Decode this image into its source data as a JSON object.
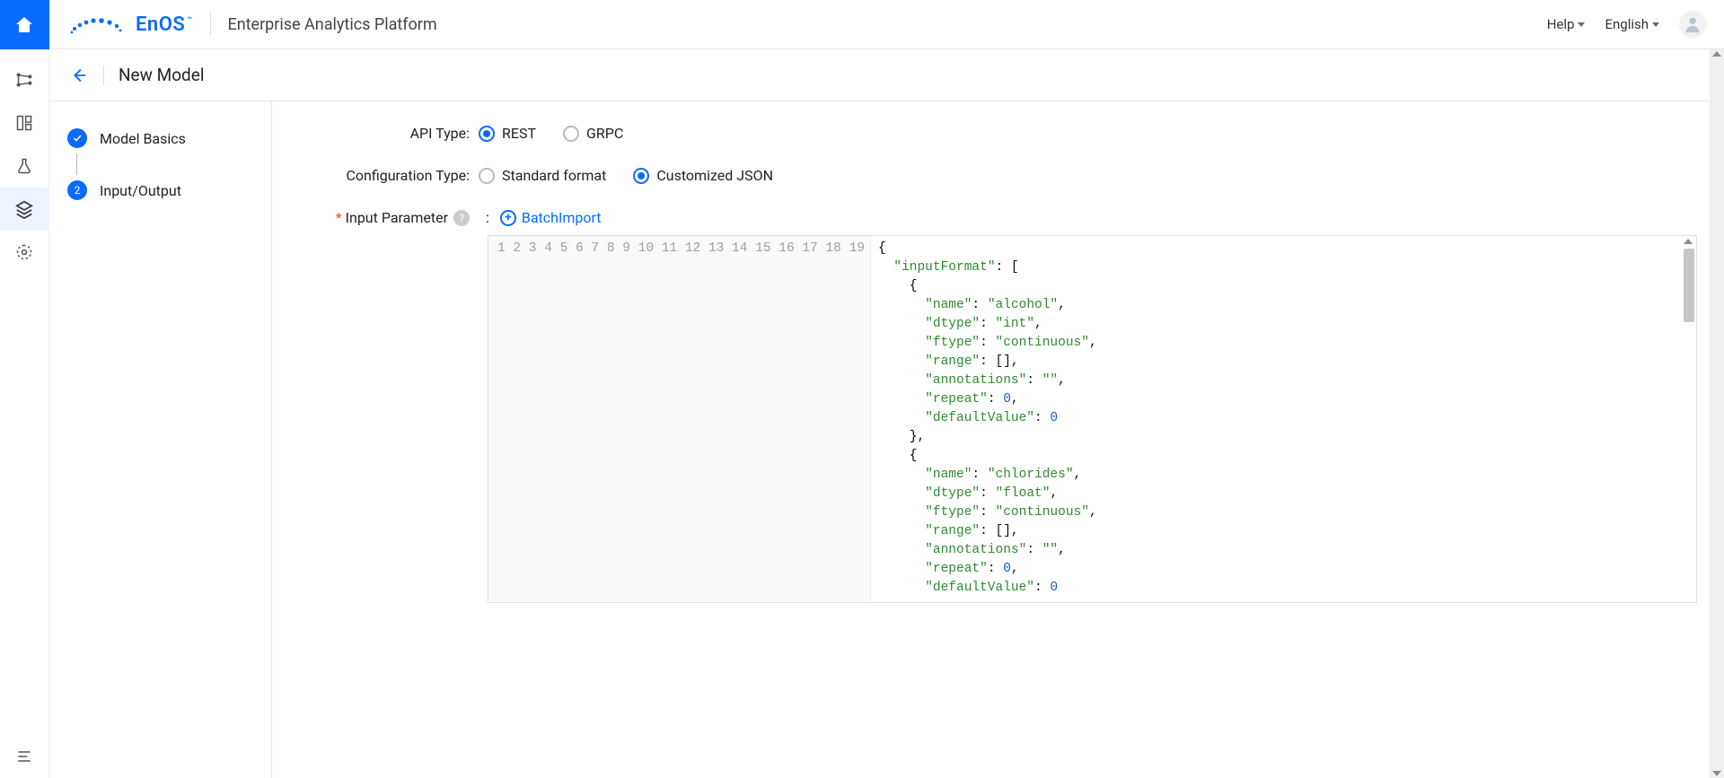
{
  "brand": {
    "name": "EnOS",
    "tm": "™",
    "product": "Enterprise Analytics Platform"
  },
  "topbar": {
    "help": "Help",
    "language": "English"
  },
  "page": {
    "title": "New Model"
  },
  "steps": [
    {
      "label": "Model Basics",
      "badge": "check"
    },
    {
      "label": "Input/Output",
      "badge": "2"
    }
  ],
  "form": {
    "api_type_label": "API Type:",
    "api_type_options": {
      "rest": "REST",
      "grpc": "GRPC"
    },
    "api_type_selected": "rest",
    "config_type_label": "Configuration Type:",
    "config_type_options": {
      "standard": "Standard format",
      "custom": "Customized JSON"
    },
    "config_type_selected": "custom",
    "input_param_label": "Input Parameter",
    "batch_import": "BatchImport"
  },
  "code": {
    "line_count": 19,
    "lines": [
      [
        {
          "t": "brace",
          "v": "{"
        }
      ],
      [
        {
          "t": "plain",
          "v": "  "
        },
        {
          "t": "key",
          "v": "\"inputFormat\""
        },
        {
          "t": "plain",
          "v": ": ["
        }
      ],
      [
        {
          "t": "plain",
          "v": "    "
        },
        {
          "t": "brace",
          "v": "{"
        }
      ],
      [
        {
          "t": "plain",
          "v": "      "
        },
        {
          "t": "key",
          "v": "\"name\""
        },
        {
          "t": "plain",
          "v": ": "
        },
        {
          "t": "str",
          "v": "\"alcohol\""
        },
        {
          "t": "plain",
          "v": ","
        }
      ],
      [
        {
          "t": "plain",
          "v": "      "
        },
        {
          "t": "key",
          "v": "\"dtype\""
        },
        {
          "t": "plain",
          "v": ": "
        },
        {
          "t": "str",
          "v": "\"int\""
        },
        {
          "t": "plain",
          "v": ","
        }
      ],
      [
        {
          "t": "plain",
          "v": "      "
        },
        {
          "t": "key",
          "v": "\"ftype\""
        },
        {
          "t": "plain",
          "v": ": "
        },
        {
          "t": "str",
          "v": "\"continuous\""
        },
        {
          "t": "plain",
          "v": ","
        }
      ],
      [
        {
          "t": "plain",
          "v": "      "
        },
        {
          "t": "key",
          "v": "\"range\""
        },
        {
          "t": "plain",
          "v": ": [],"
        }
      ],
      [
        {
          "t": "plain",
          "v": "      "
        },
        {
          "t": "key",
          "v": "\"annotations\""
        },
        {
          "t": "plain",
          "v": ": "
        },
        {
          "t": "str",
          "v": "\"\""
        },
        {
          "t": "plain",
          "v": ","
        }
      ],
      [
        {
          "t": "plain",
          "v": "      "
        },
        {
          "t": "key",
          "v": "\"repeat\""
        },
        {
          "t": "plain",
          "v": ": "
        },
        {
          "t": "num",
          "v": "0"
        },
        {
          "t": "plain",
          "v": ","
        }
      ],
      [
        {
          "t": "plain",
          "v": "      "
        },
        {
          "t": "key",
          "v": "\"defaultValue\""
        },
        {
          "t": "plain",
          "v": ": "
        },
        {
          "t": "num",
          "v": "0"
        }
      ],
      [
        {
          "t": "plain",
          "v": "    "
        },
        {
          "t": "brace",
          "v": "}"
        },
        {
          "t": "plain",
          "v": ","
        }
      ],
      [
        {
          "t": "plain",
          "v": "    "
        },
        {
          "t": "brace",
          "v": "{"
        }
      ],
      [
        {
          "t": "plain",
          "v": "      "
        },
        {
          "t": "key",
          "v": "\"name\""
        },
        {
          "t": "plain",
          "v": ": "
        },
        {
          "t": "str",
          "v": "\"chlorides\""
        },
        {
          "t": "plain",
          "v": ","
        }
      ],
      [
        {
          "t": "plain",
          "v": "      "
        },
        {
          "t": "key",
          "v": "\"dtype\""
        },
        {
          "t": "plain",
          "v": ": "
        },
        {
          "t": "str",
          "v": "\"float\""
        },
        {
          "t": "plain",
          "v": ","
        }
      ],
      [
        {
          "t": "plain",
          "v": "      "
        },
        {
          "t": "key",
          "v": "\"ftype\""
        },
        {
          "t": "plain",
          "v": ": "
        },
        {
          "t": "str",
          "v": "\"continuous\""
        },
        {
          "t": "plain",
          "v": ","
        }
      ],
      [
        {
          "t": "plain",
          "v": "      "
        },
        {
          "t": "key",
          "v": "\"range\""
        },
        {
          "t": "plain",
          "v": ": [],"
        }
      ],
      [
        {
          "t": "plain",
          "v": "      "
        },
        {
          "t": "key",
          "v": "\"annotations\""
        },
        {
          "t": "plain",
          "v": ": "
        },
        {
          "t": "str",
          "v": "\"\""
        },
        {
          "t": "plain",
          "v": ","
        }
      ],
      [
        {
          "t": "plain",
          "v": "      "
        },
        {
          "t": "key",
          "v": "\"repeat\""
        },
        {
          "t": "plain",
          "v": ": "
        },
        {
          "t": "num",
          "v": "0"
        },
        {
          "t": "plain",
          "v": ","
        }
      ],
      [
        {
          "t": "plain",
          "v": "      "
        },
        {
          "t": "key",
          "v": "\"defaultValue\""
        },
        {
          "t": "plain",
          "v": ": "
        },
        {
          "t": "num",
          "v": "0"
        }
      ]
    ]
  }
}
